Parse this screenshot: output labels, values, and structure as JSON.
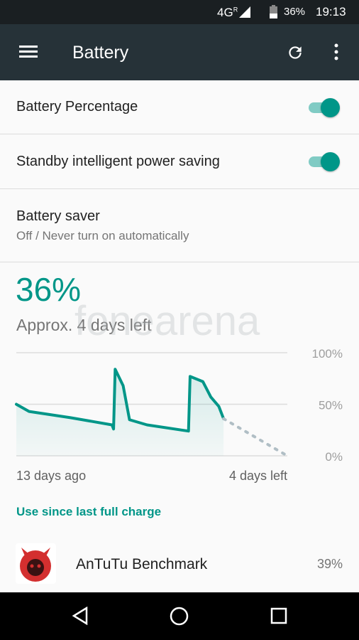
{
  "status_bar": {
    "network": "4G",
    "roaming": "R",
    "battery": "36%",
    "time": "19:13"
  },
  "app_bar": {
    "title": "Battery",
    "icons": [
      "menu-icon",
      "refresh-icon",
      "more-vert-icon"
    ]
  },
  "settings": [
    {
      "label": "Battery Percentage",
      "toggle": true
    },
    {
      "label": "Standby intelligent power saving",
      "toggle": true
    },
    {
      "label": "Battery saver",
      "summary": "Off / Never turn on automatically"
    }
  ],
  "battery": {
    "level": "36%",
    "estimate": "Approx. 4 days left"
  },
  "watermark": "fonearena",
  "chart_data": {
    "type": "line",
    "x_unit": "days",
    "xlim": [
      -13,
      4
    ],
    "ylim": [
      0,
      100
    ],
    "y_ticks": [
      "100%",
      "50%",
      "0%"
    ],
    "x_labels": [
      "13 days ago",
      "4 days left"
    ],
    "grid": true,
    "series": [
      {
        "style": "solid",
        "x": [
          -13,
          -12.2,
          -9.6,
          -7.0,
          -6.9,
          -6.8,
          -6.3,
          -5.9,
          -4.8,
          -2.2,
          -2.1,
          -1.3,
          -0.8,
          -0.3,
          0
        ],
        "y": [
          50,
          43,
          37,
          30,
          26,
          84,
          68,
          35,
          30,
          24,
          77,
          72,
          57,
          48,
          36
        ]
      },
      {
        "style": "dotted",
        "x": [
          0,
          4
        ],
        "y": [
          36,
          0
        ]
      }
    ],
    "colors": {
      "line": "#009688",
      "projection": "#b0bec5"
    }
  },
  "usage": {
    "header": "Use since last full charge",
    "apps": [
      {
        "name": "AnTuTu Benchmark",
        "percent": "39%"
      }
    ]
  },
  "nav_bar": {
    "icons": [
      "back-icon",
      "home-icon",
      "recents-icon"
    ]
  }
}
